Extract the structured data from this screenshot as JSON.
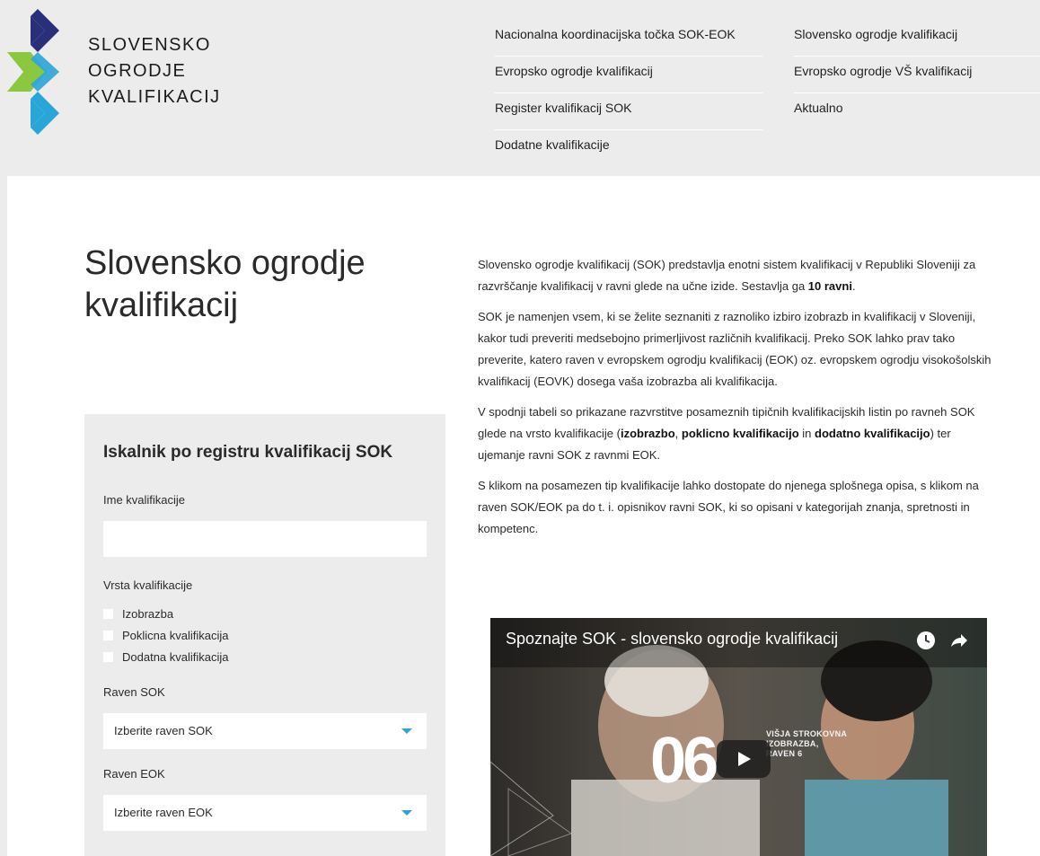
{
  "brand": {
    "line1": "SLOVENSKO",
    "line2": "OGRODJE",
    "line3": "KVALIFIKACIJ",
    "colors": {
      "navy": "#2a2f7a",
      "green": "#8dc63f",
      "blue": "#2aa5d8"
    }
  },
  "nav": {
    "left": [
      "Nacionalna koordinacijska točka SOK-EOK",
      "Evropsko ogrodje kvalifikacij",
      "Register kvalifikacij SOK",
      "Dodatne kvalifikacije"
    ],
    "right": [
      "Slovensko ogrodje kvalifikacij",
      "Evropsko ogrodje VŠ kvalifikacij",
      "Aktualno"
    ]
  },
  "page": {
    "title": "Slovensko ogrodje kvalifikacij"
  },
  "search": {
    "title": "Iskalnik po registru kvalifikacij SOK",
    "name_label": "Ime kvalifikacije",
    "name_value": "",
    "type_label": "Vrsta kvalifikacije",
    "types": [
      "Izobrazba",
      "Poklicna kvalifikacija",
      "Dodatna kvalifikacija"
    ],
    "sok_label": "Raven SOK",
    "sok_selected": "Izberite raven SOK",
    "eok_label": "Raven EOK",
    "eok_selected": "Izberite raven EOK",
    "accent_color": "#2aa5d8"
  },
  "content": {
    "p1_a": "Slovensko ogrodje kvalifikacij (SOK) predstavlja enotni sistem kvalifikacij v Republiki Sloveniji za razvrščanje kvalifikacij v ravni glede na učne izide. Sestavlja ga ",
    "p1_b": "10 ravni",
    "p1_c": ".",
    "p2": "SOK je namenjen vsem, ki se želite seznaniti z raznoliko izbiro izobrazb in kvalifikacij v Sloveniji, kakor tudi preveriti medsebojno primerljivost različnih kvalifikacij. Preko SOK lahko prav tako preverite, katero raven v evropskem ogrodju kvalifikacij (EOK) oz. evropskem ogrodju visokošolskih kvalifikacij (EOVK) dosega vaša izobrazba ali kvalifikacija.",
    "p3_a": "V spodnji tabeli so prikazane razvrstitve posameznih tipičnih kvalifikacijskih listin po ravneh SOK glede na vrsto kvalifikacije (",
    "p3_b": "izobrazbo",
    "p3_c": ", ",
    "p3_d": "poklicno kvalifikacijo",
    "p3_e": " in ",
    "p3_f": "dodatno kvalifikacijo",
    "p3_g": ") ter ujemanje ravni SOK z ravnmi EOK.",
    "p4": "S klikom na posamezen tip kvalifikacije lahko dostopate do njenega splošnega opisa, s klikom na raven SOK/EOK pa do t. i. opisnikov ravni SOK, ki so opisani v kategorijah znanja, spretnosti in kompetenc."
  },
  "video": {
    "title": "Spoznajte SOK - slovensko ogrodje kvalifikacij",
    "big_number": "06",
    "overlay_line1": "VIŠJA STROKOVNA",
    "overlay_line2": "IZOBRAZBA,",
    "overlay_line3": "RAVEN 6",
    "icons": [
      "clock-icon",
      "share-icon",
      "play-icon"
    ]
  }
}
